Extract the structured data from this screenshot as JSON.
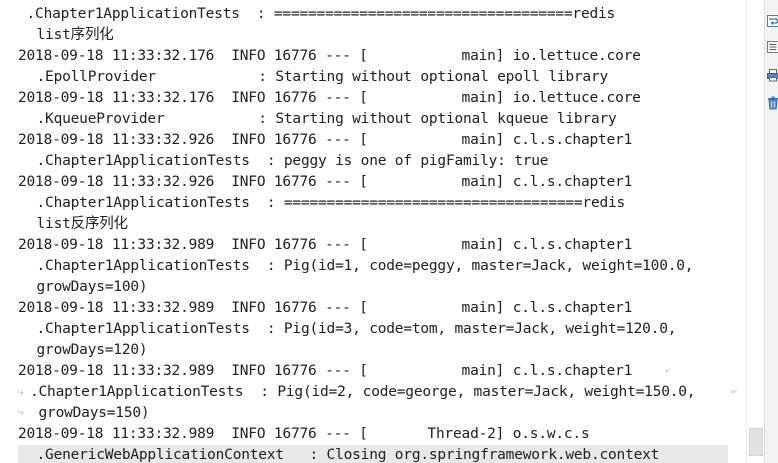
{
  "console": {
    "lines": [
      " .Chapter1ApplicationTests  : ===================================redis",
      " list序列化",
      "2018-09-18 11:33:32.176  INFO 16776 --- [           main] io.lettuce.core",
      " .EpollProvider            : Starting without optional epoll library",
      "2018-09-18 11:33:32.176  INFO 16776 --- [           main] io.lettuce.core",
      " .KqueueProvider           : Starting without optional kqueue library",
      "2018-09-18 11:33:32.926  INFO 16776 --- [           main] c.l.s.chapter1",
      " .Chapter1ApplicationTests  : peggy is one of pigFamily: true",
      "2018-09-18 11:33:32.926  INFO 16776 --- [           main] c.l.s.chapter1",
      " .Chapter1ApplicationTests  : ===================================redis",
      " list反序列化",
      "2018-09-18 11:33:32.989  INFO 16776 --- [           main] c.l.s.chapter1",
      " .Chapter1ApplicationTests  : Pig(id=1, code=peggy, master=Jack, weight=100.0,",
      " growDays=100)",
      "2018-09-18 11:33:32.989  INFO 16776 --- [           main] c.l.s.chapter1",
      " .Chapter1ApplicationTests  : Pig(id=3, code=tom, master=Jack, weight=120.0,",
      " growDays=120)",
      "2018-09-18 11:33:32.989  INFO 16776 --- [           main] c.l.s.chapter1",
      ".Chapter1ApplicationTests  : Pig(id=2, code=george, master=Jack, weight=150.0,",
      " growDays=150)",
      "2018-09-18 11:33:32.989  INFO 16776 --- [       Thread-2] o.s.w.c.s",
      " .GenericWebApplicationContext   : Closing org.springframework.web.context"
    ]
  },
  "toolbar": {
    "icons": [
      "soft-wrap-icon",
      "scroll-to-end-icon",
      "print-icon",
      "trash-icon"
    ]
  }
}
